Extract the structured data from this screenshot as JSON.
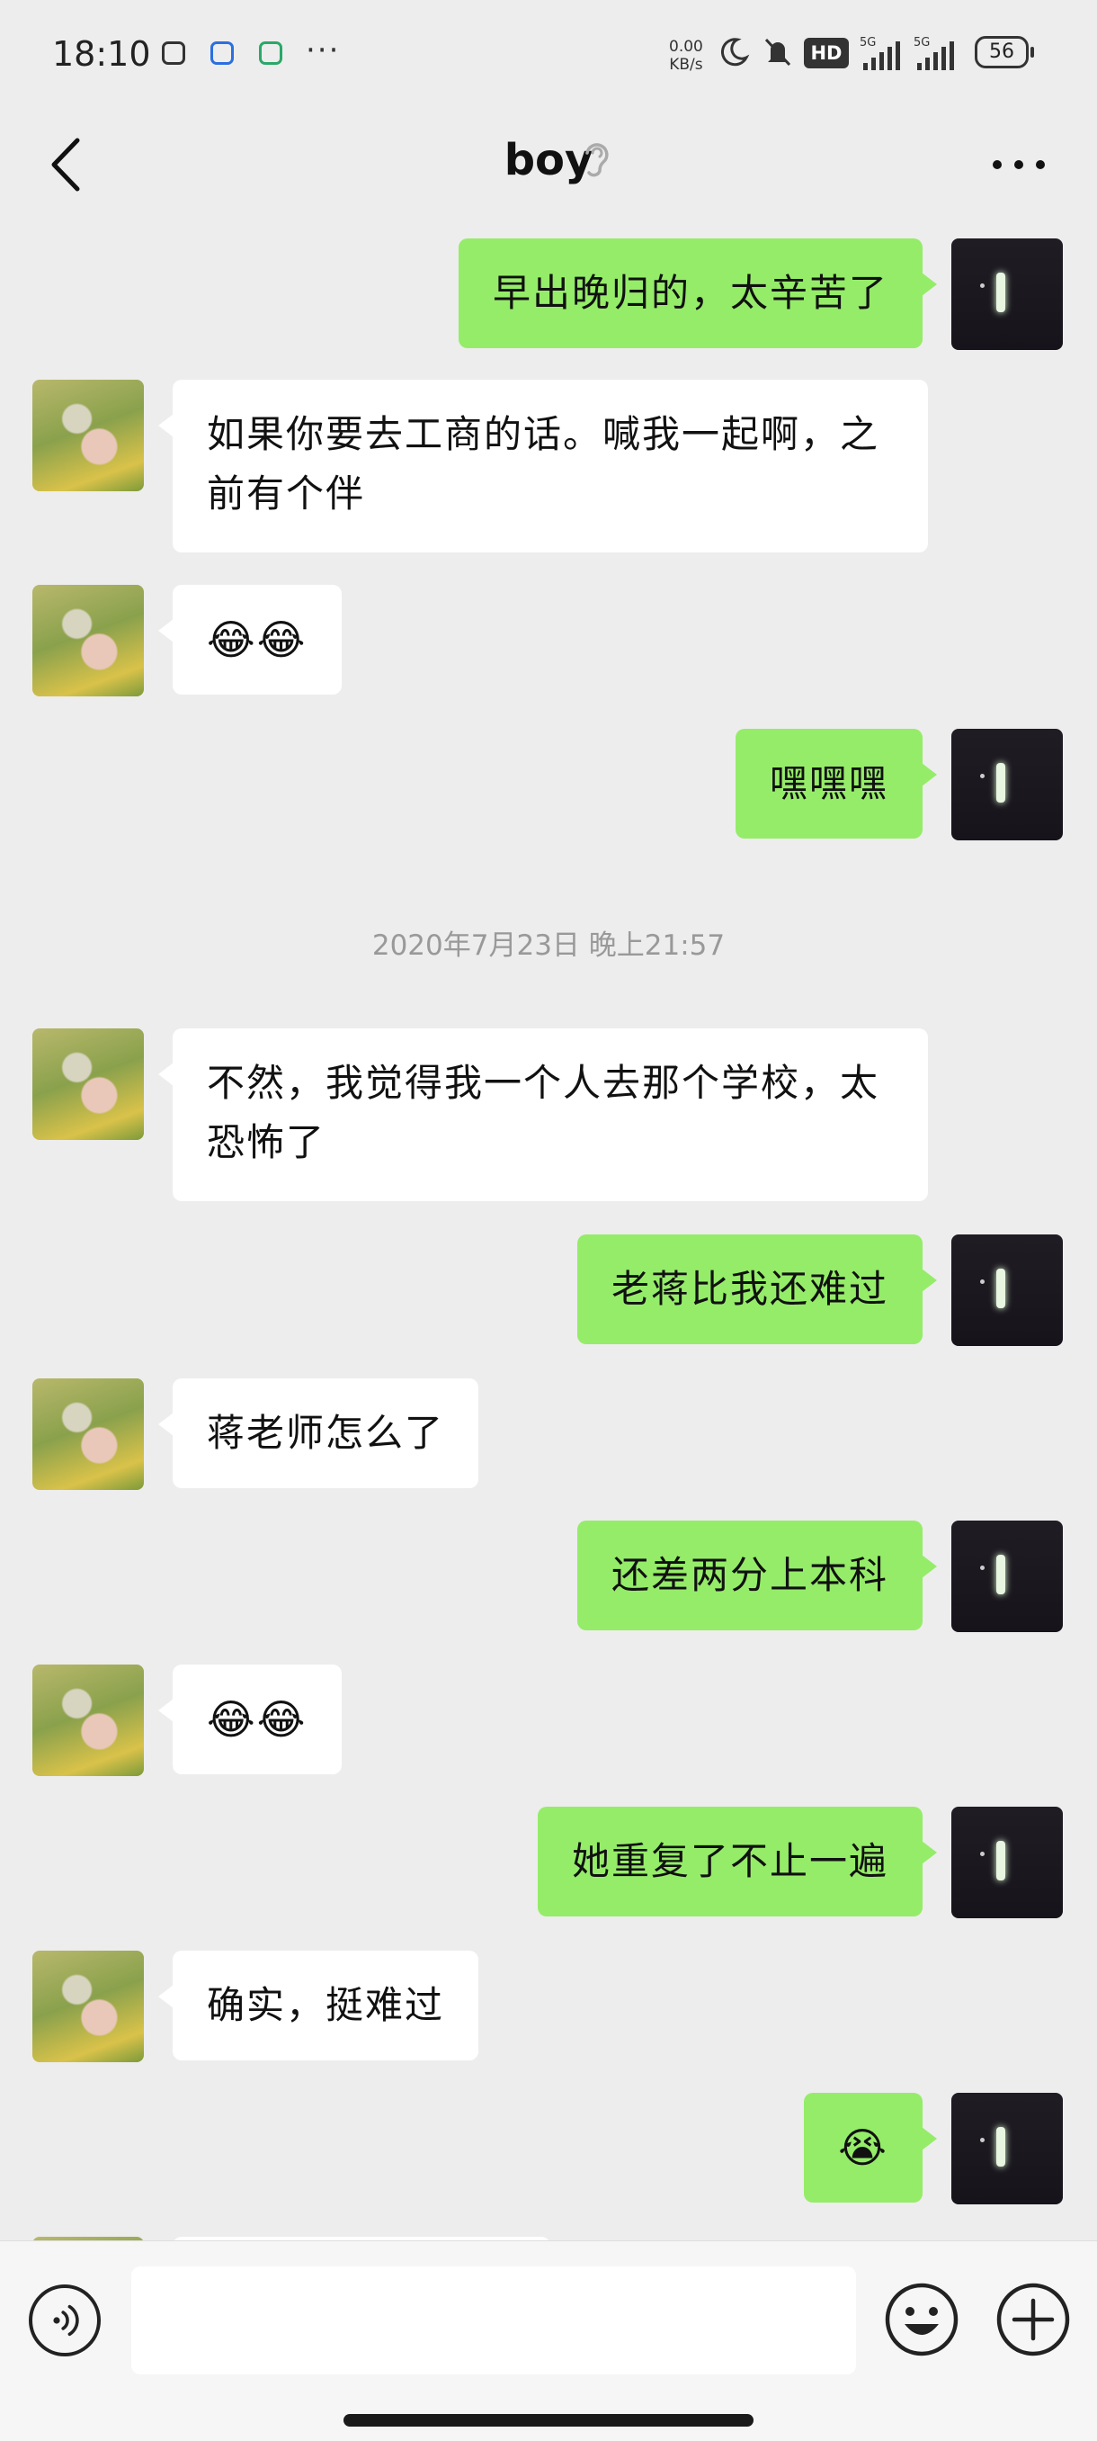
{
  "status_bar": {
    "time": "18:10",
    "net_speed_value": "0.00",
    "net_speed_unit": "KB/s",
    "hd_label": "HD",
    "signal_1_label": "5G",
    "signal_2_label": "5G",
    "battery": "56",
    "more": "···"
  },
  "header": {
    "title": "boy",
    "back_icon": "chevron-left-icon",
    "ear_icon": "ear-icon",
    "more_icon": "more-dots-icon"
  },
  "messages": [
    {
      "from": "me",
      "text": "早出晚归的，太辛苦了"
    },
    {
      "from": "other",
      "text": "如果你要去工商的话。喊我一起啊，之前有个伴"
    },
    {
      "from": "other",
      "text": "😂😂"
    },
    {
      "from": "me",
      "text": "嘿嘿嘿"
    },
    {
      "type": "timestamp",
      "text": "2020年7月23日 晚上21:57"
    },
    {
      "from": "other",
      "text": "不然，我觉得我一个人去那个学校，太恐怖了"
    },
    {
      "from": "me",
      "text": "老蒋比我还难过"
    },
    {
      "from": "other",
      "text": "蒋老师怎么了"
    },
    {
      "from": "me",
      "text": "还差两分上本科"
    },
    {
      "from": "other",
      "text": "😂😂"
    },
    {
      "from": "me",
      "text": "她重复了不止一遍"
    },
    {
      "from": "other",
      "text": "确实，挺难过"
    },
    {
      "from": "me",
      "text": "😭"
    }
  ],
  "input_bar": {
    "voice_icon": "voice-icon",
    "text_value": "",
    "emoji_icon": "smiley-icon",
    "plus_icon": "plus-icon"
  }
}
